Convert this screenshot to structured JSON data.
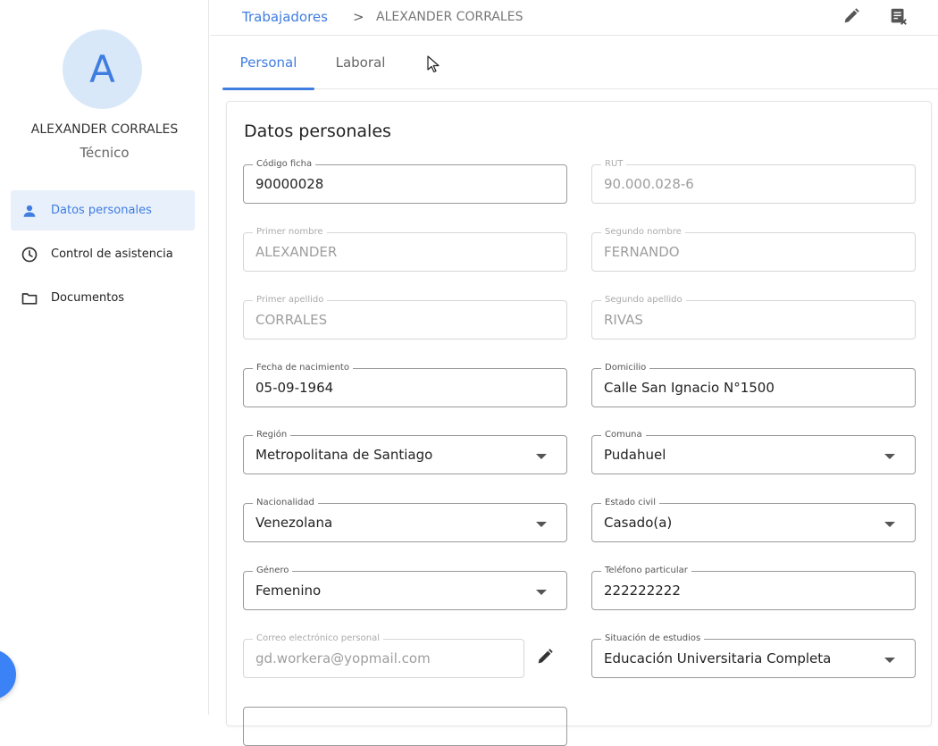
{
  "sidebar": {
    "avatar_letter": "A",
    "user_name": "ALEXANDER CORRALES",
    "user_role": "Técnico",
    "items": [
      {
        "label": "Datos personales",
        "icon": "person-icon",
        "active": true
      },
      {
        "label": "Control de asistencia",
        "icon": "clock-icon",
        "active": false
      },
      {
        "label": "Documentos",
        "icon": "folder-icon",
        "active": false
      }
    ]
  },
  "breadcrumb": {
    "parent": "Trabajadores",
    "separator": ">",
    "current": "ALEXANDER CORRALES"
  },
  "toolbar": {
    "edit_icon": "pencil-icon",
    "report_icon": "document-close-icon"
  },
  "tabs": [
    {
      "label": "Personal",
      "active": true
    },
    {
      "label": "Laboral",
      "active": false
    }
  ],
  "form": {
    "title": "Datos personales",
    "codigo_ficha": {
      "label": "Código ficha",
      "value": "90000028"
    },
    "rut": {
      "label": "RUT",
      "value": "90.000.028-6"
    },
    "primer_nombre": {
      "label": "Primer nombre",
      "value": "ALEXANDER"
    },
    "segundo_nombre": {
      "label": "Segundo nombre",
      "value": "FERNANDO"
    },
    "primer_apellido": {
      "label": "Primer apellido",
      "value": "CORRALES"
    },
    "segundo_apellido": {
      "label": "Segundo apellido",
      "value": "RIVAS"
    },
    "fecha_nacimiento": {
      "label": "Fecha de nacimiento",
      "value": "05-09-1964"
    },
    "domicilio": {
      "label": "Domicilio",
      "value": "Calle San Ignacio N°1500"
    },
    "region": {
      "label": "Región",
      "value": "Metropolitana de Santiago"
    },
    "comuna": {
      "label": "Comuna",
      "value": "Pudahuel"
    },
    "nacionalidad": {
      "label": "Nacionalidad",
      "value": "Venezolana"
    },
    "estado_civil": {
      "label": "Estado civil",
      "value": "Casado(a)"
    },
    "genero": {
      "label": "Género",
      "value": "Femenino"
    },
    "telefono": {
      "label": "Teléfono particular",
      "value": "222222222"
    },
    "correo": {
      "label": "Correo electrónico personal",
      "value": "gd.workera@yopmail.com"
    },
    "situacion_estudios": {
      "label": "Situación de estudios",
      "value": "Educación Universitaria Completa"
    }
  },
  "colors": {
    "accent": "#3f7de0",
    "active_nav_bg": "#e8f0fb",
    "avatar_bg": "#d9e8f8",
    "fab": "#3b82f6"
  }
}
